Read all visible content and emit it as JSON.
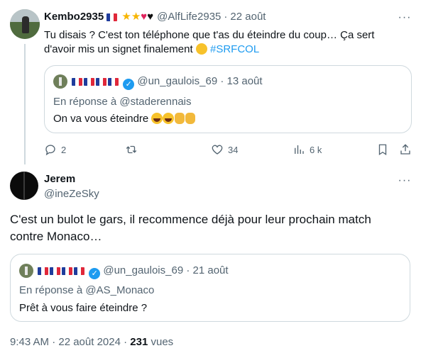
{
  "tweet1": {
    "display_name": "Kembo2935",
    "handle": "@AlfLife2935",
    "date": "22 août",
    "text_line1": "Tu disais ? C'est ton téléphone que t'as du éteindre du coup… Ça sert",
    "text_line2": "d'avoir mis un signet finalement",
    "hashtag": "#SRFCOL",
    "quote": {
      "handle": "@un_gaulois_69",
      "date": "13 août",
      "reply_to": "En réponse à @staderennais",
      "text": "On va vous éteindre"
    },
    "actions": {
      "replies": "2",
      "retweets": "",
      "likes": "34",
      "views": "6 k"
    }
  },
  "tweet2": {
    "display_name": "Jerem",
    "handle": "@ineZeSky",
    "text_line1": "C'est un bulot le gars, il recommence déjà pour leur prochain match",
    "text_line2": "contre Monaco…",
    "quote": {
      "handle": "@un_gaulois_69",
      "date": "21 août",
      "reply_to": "En réponse à @AS_Monaco",
      "text": "Prêt à vous faire éteindre ?"
    },
    "timestamp": "9:43 AM · 22 août 2024 · ",
    "views_count": "231",
    "views_label": " vues"
  },
  "common": {
    "separator": "·",
    "more_glyph": "···",
    "verified_glyph": "✓"
  },
  "colors": {
    "accent": "#1d9bf0",
    "muted": "#536471",
    "border": "#cfd9de"
  }
}
